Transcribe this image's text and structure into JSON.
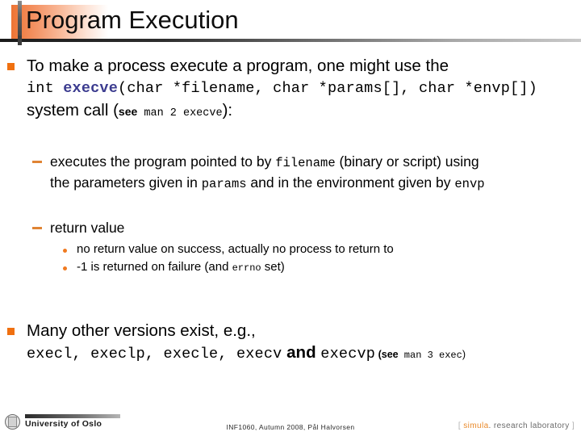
{
  "slide": {
    "title": "Program Execution",
    "accent_orange": "#f07010",
    "code_navy": "#3b3b8f"
  },
  "body": {
    "bullet1": {
      "line1": "To make a process execute a program, one might use the",
      "code_prefix": "int ",
      "code_name": "execve",
      "code_signature": "(char *filename, char *params[], char *envp[])",
      "line3_a": "system call (",
      "line3_see": "see",
      "line3_man": " man 2 execve",
      "line3_b": "):"
    },
    "sub1": {
      "line1_a": "executes the program pointed to by ",
      "line1_code": "filename",
      "line1_b": " (binary or script) using",
      "line2_a": "the parameters given in ",
      "line2_code1": "params",
      "line2_b": " and in the environment given by ",
      "line2_code2": "envp"
    },
    "sub2": {
      "label": "return value",
      "items": [
        {
          "a": "no return value on success, actually no process to return to",
          "code": "",
          "b": ""
        },
        {
          "a": "-1 is returned on failure (and ",
          "code": "errno",
          "b": " set)"
        }
      ]
    },
    "bullet2": {
      "line1": "Many other versions exist, e.g.,",
      "variants": "execl, execlp, execle, execv",
      "and_word": " and ",
      "variant_last": "execvp",
      "paren_open": " (",
      "see": "see",
      "man": " man 3 exec",
      "paren_close": ")"
    }
  },
  "footer": {
    "university": "University of Oslo",
    "course_line": "INF1060,  Autumn 2008,  Pål Halvorsen",
    "simula_open": "[ ",
    "simula_brand": "simula",
    "simula_rest": ". research laboratory",
    "simula_close": " ]"
  }
}
